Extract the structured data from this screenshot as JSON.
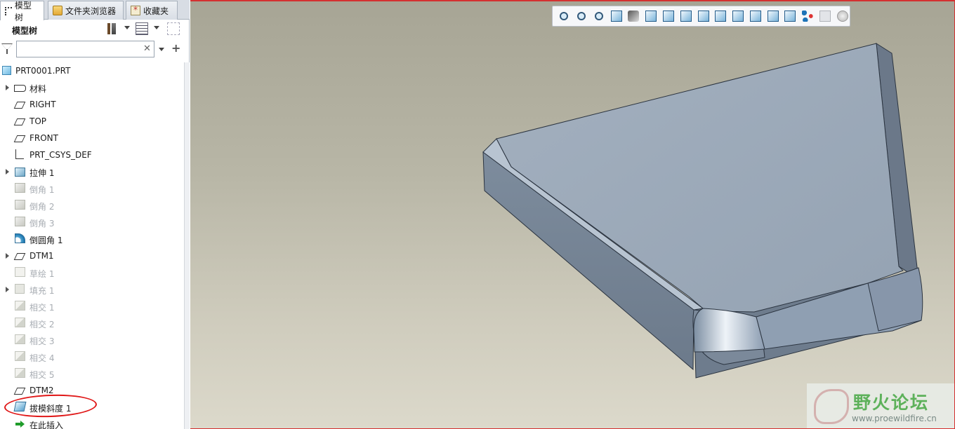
{
  "tabs": [
    {
      "label": "模型树",
      "icon": "model-tree-icon"
    },
    {
      "label": "文件夹浏览器",
      "icon": "folder-icon"
    },
    {
      "label": "收藏夹",
      "icon": "favorites-icon"
    }
  ],
  "panel": {
    "title": "模型树",
    "search_value": ""
  },
  "tree": [
    {
      "label": "PRT0001.PRT",
      "icon": "part-icon",
      "expandable": false,
      "dim": false
    },
    {
      "label": "材料",
      "icon": "material-icon",
      "expandable": true,
      "dim": false
    },
    {
      "label": "RIGHT",
      "icon": "datum-plane-icon",
      "expandable": false,
      "dim": false
    },
    {
      "label": "TOP",
      "icon": "datum-plane-icon",
      "expandable": false,
      "dim": false
    },
    {
      "label": "FRONT",
      "icon": "datum-plane-icon",
      "expandable": false,
      "dim": false
    },
    {
      "label": "PRT_CSYS_DEF",
      "icon": "coordinate-system-icon",
      "expandable": false,
      "dim": false
    },
    {
      "label": "拉伸 1",
      "icon": "extrude-icon",
      "expandable": true,
      "dim": false
    },
    {
      "label": "倒角 1",
      "icon": "chamfer-icon",
      "expandable": false,
      "dim": true
    },
    {
      "label": "倒角 2",
      "icon": "chamfer-icon",
      "expandable": false,
      "dim": true
    },
    {
      "label": "倒角 3",
      "icon": "chamfer-icon",
      "expandable": false,
      "dim": true
    },
    {
      "label": "倒圆角 1",
      "icon": "round-icon",
      "expandable": false,
      "dim": false
    },
    {
      "label": "DTM1",
      "icon": "datum-plane-icon",
      "expandable": true,
      "dim": false
    },
    {
      "label": "草绘 1",
      "icon": "sketch-icon",
      "expandable": false,
      "dim": true
    },
    {
      "label": "填充 1",
      "icon": "fill-icon",
      "expandable": true,
      "dim": true
    },
    {
      "label": "相交 1",
      "icon": "intersect-icon",
      "expandable": false,
      "dim": true
    },
    {
      "label": "相交 2",
      "icon": "intersect-icon",
      "expandable": false,
      "dim": true
    },
    {
      "label": "相交 3",
      "icon": "intersect-icon",
      "expandable": false,
      "dim": true
    },
    {
      "label": "相交 4",
      "icon": "intersect-icon",
      "expandable": false,
      "dim": true
    },
    {
      "label": "相交 5",
      "icon": "intersect-icon",
      "expandable": false,
      "dim": true
    },
    {
      "label": "DTM2",
      "icon": "datum-plane-icon",
      "expandable": false,
      "dim": false
    },
    {
      "label": "拔模斜度 1",
      "icon": "draft-icon",
      "expandable": false,
      "dim": false,
      "highlighted": true
    },
    {
      "label": "在此插入",
      "icon": "insert-here-icon",
      "expandable": false,
      "dim": false
    }
  ],
  "view_toolbar": [
    "refit-icon",
    "zoom-in-icon",
    "zoom-out-icon",
    "repaint-icon",
    "display-style-icon",
    "saved-orientations-icon",
    "named-views-icon",
    "layers-icon",
    "datum-planes-icon",
    "datum-axes-icon",
    "datum-points-icon",
    "csys-display-icon",
    "spin-center-icon",
    "annotation-display-icon",
    "network-icon",
    "dimmed-icon",
    "status-icon"
  ],
  "colors": {
    "highlight_circle": "#e01818",
    "watermark_green": "#5db15a",
    "part_top_face": "#9aa8b8"
  },
  "watermark": {
    "title": "野火论坛",
    "url": "www.proewildfire.cn"
  }
}
